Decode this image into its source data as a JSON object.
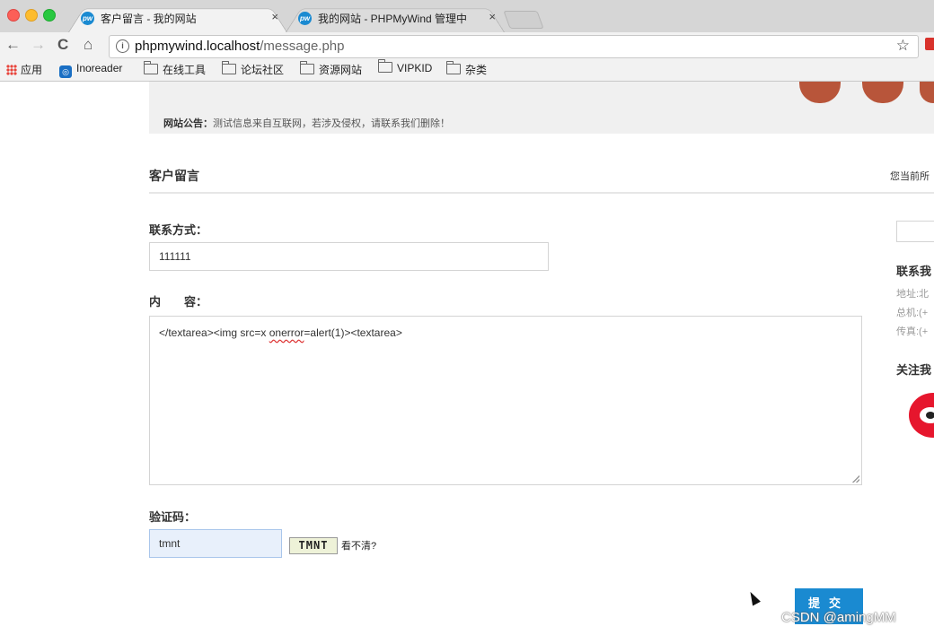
{
  "browser": {
    "tabs": [
      {
        "title": "客户留言 - 我的网站",
        "close": "×",
        "active": true
      },
      {
        "title": "我的网站 - PHPMyWind 管理中",
        "close": "×",
        "active": false
      }
    ],
    "nav": {
      "back": "←",
      "forward": "→",
      "reload": "C",
      "home": "⌂"
    },
    "address": {
      "info_icon": "i",
      "host": "phpmywind.localhost",
      "path": "/message.php",
      "star": "☆"
    },
    "bookmarks": [
      "应用",
      "Inoreader",
      "在线工具",
      "论坛社区",
      "资源网站",
      "VIPKID",
      "杂类"
    ]
  },
  "page": {
    "notice_label": "网站公告：",
    "notice_text": "测试信息来自互联网，若涉及侵权，请联系我们删除！",
    "section_title": "客户留言",
    "breadcrumb": "您当前所",
    "contact_label": "联系方式：",
    "contact_value": "111111",
    "content_label": "内　　容：",
    "content_value_before": "</textarea><img src=x ",
    "content_value_misspelled": "onerror",
    "content_value_after": "=alert(1)><textarea>",
    "captcha_label": "验证码：",
    "captcha_value": "tmnt",
    "captcha_image_text": "TMNT",
    "captcha_refresh": "看不清?",
    "submit_label": "提交"
  },
  "sidebar": {
    "contact_heading": "联系我",
    "lines": [
      "地址:北",
      "总机:(+",
      "传真:(+"
    ],
    "follow_heading": "关注我"
  },
  "watermark": "CSDN @amingMM",
  "colors": {
    "accent": "#1a8ad1",
    "tab_strip": "#d6d6d6",
    "captcha_bg": "#e8f0fb",
    "weibo_red": "#e6162d"
  }
}
